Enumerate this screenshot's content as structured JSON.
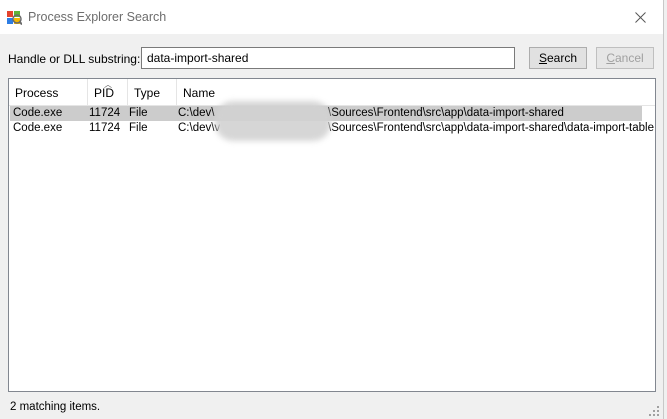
{
  "window": {
    "title": "Process Explorer Search"
  },
  "search": {
    "label": "Handle or DLL substring:",
    "value": "data-import-shared",
    "search_label": "Search",
    "search_rest": "earch",
    "search_hotkey": "S",
    "cancel_label": "Cancel",
    "cancel_hotkey": "C",
    "cancel_rest": "ancel"
  },
  "table": {
    "columns": [
      "Process",
      "PID",
      "Type",
      "Name"
    ],
    "rows": [
      {
        "process": "Code.exe",
        "pid": "11724",
        "type": "File",
        "name_prefix": "C:\\dev\\",
        "name_suffix": "\\Sources\\Frontend\\src\\app\\data-import-shared",
        "selected": true
      },
      {
        "process": "Code.exe",
        "pid": "11724",
        "type": "File",
        "name_prefix": "C:\\dev\\v",
        "name_suffix": "\\Sources\\Frontend\\src\\app\\data-import-shared\\data-import-table",
        "selected": false
      }
    ]
  },
  "status": {
    "text": "2 matching items."
  },
  "icons": {
    "app": "process-explorer-icon",
    "close": "close-icon",
    "sort": "sort-ascending-icon",
    "grip": "resize-grip-icon"
  }
}
